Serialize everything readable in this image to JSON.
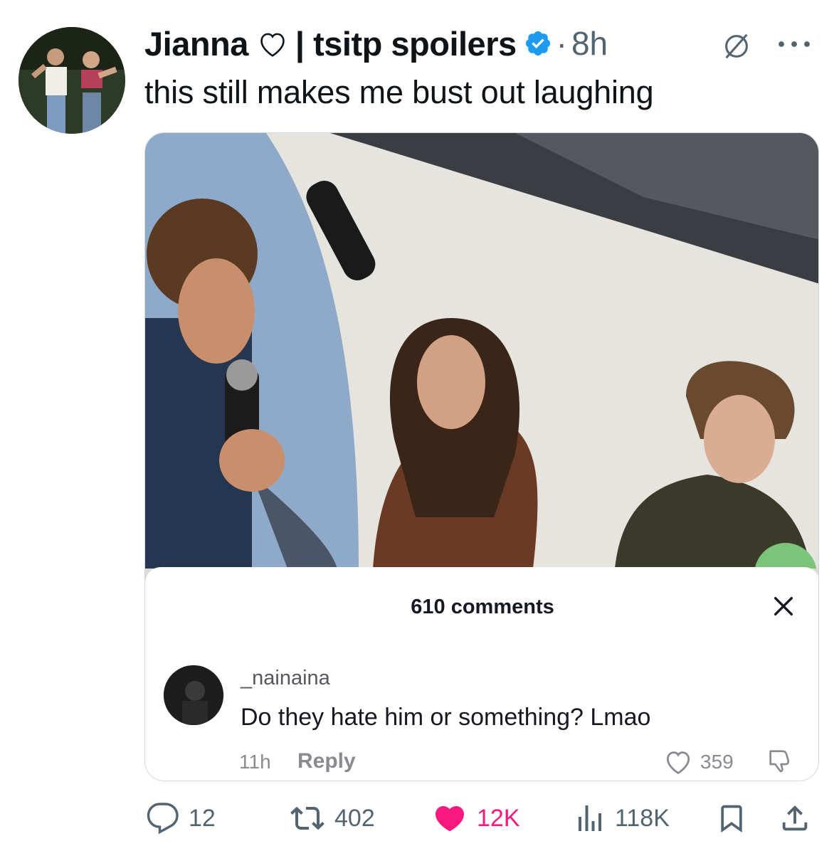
{
  "tweet": {
    "author": {
      "display_name": "Jianna",
      "name_suffix": "| tsitp spoilers",
      "verified": true,
      "avatar_icon": "profile-photo"
    },
    "separator": "·",
    "time": "8h",
    "text": "this still makes me bust out laughing",
    "media": {
      "photo_icon": "photo-of-three-people-on-stage",
      "comments_overlay": {
        "count_label": "610 comments",
        "comment": {
          "username": "_nainaina",
          "text": "Do they hate him or something? Lmao",
          "time": "11h",
          "reply_label": "Reply",
          "likes": "359"
        }
      }
    },
    "actions": {
      "replies": "12",
      "reposts": "402",
      "likes": "12K",
      "views": "118K"
    }
  },
  "colors": {
    "text": "#0f1419",
    "secondary": "#536471",
    "verified": "#1d9bf0",
    "like": "#f91880",
    "border": "#cfd9de"
  }
}
